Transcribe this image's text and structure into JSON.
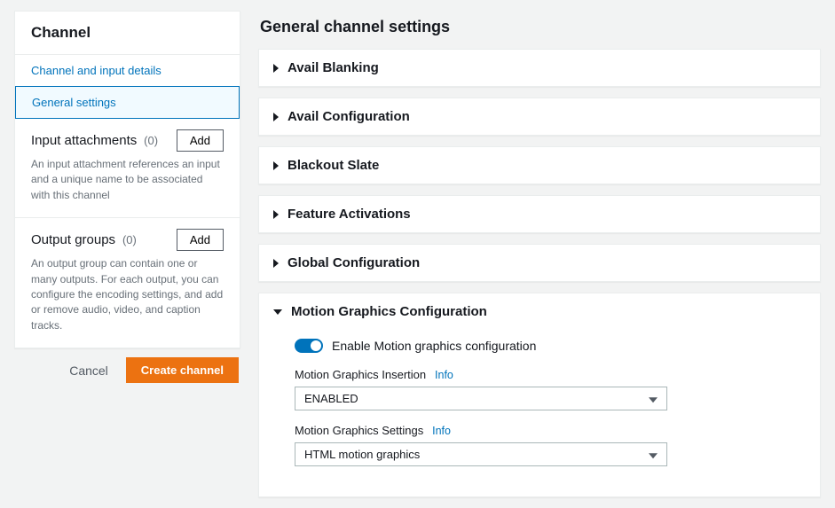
{
  "sidebar": {
    "title": "Channel",
    "nav": {
      "details": "Channel and input details",
      "general": "General settings"
    },
    "inputs": {
      "title": "Input attachments",
      "count": "(0)",
      "add": "Add",
      "desc": "An input attachment references an input and a unique name to be associated with this channel"
    },
    "outputs": {
      "title": "Output groups",
      "count": "(0)",
      "add": "Add",
      "desc": "An output group can contain one or many outputs. For each output, you can configure the encoding settings, and add or remove audio, video, and caption tracks."
    },
    "actions": {
      "cancel": "Cancel",
      "create": "Create channel"
    }
  },
  "main": {
    "title": "General channel settings",
    "panels": {
      "avail_blanking": "Avail Blanking",
      "avail_config": "Avail Configuration",
      "blackout": "Blackout Slate",
      "feature": "Feature Activations",
      "global": "Global Configuration",
      "motion": {
        "title": "Motion Graphics Configuration",
        "toggle_label": "Enable Motion graphics configuration",
        "insertion_label": "Motion Graphics Insertion",
        "insertion_value": "ENABLED",
        "settings_label": "Motion Graphics Settings",
        "settings_value": "HTML motion graphics",
        "info": "Info"
      }
    }
  }
}
